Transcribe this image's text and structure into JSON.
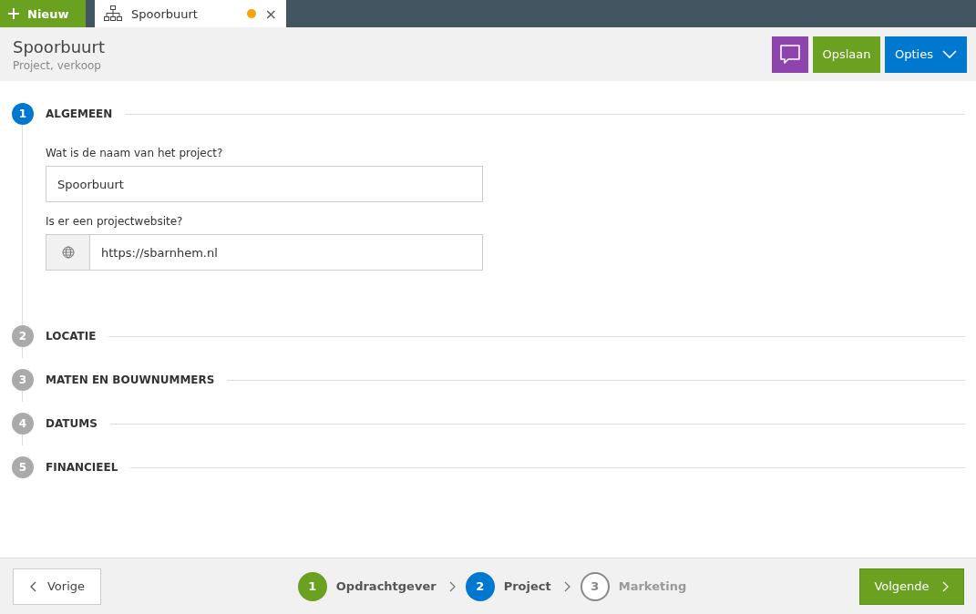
{
  "top_bar": {
    "new_button": {
      "label": "Nieuw"
    },
    "tabs": [
      {
        "label": "Spoorbuurt",
        "selected": true,
        "unsaved": true,
        "close": "×"
      }
    ]
  },
  "header": {
    "title": "Spoorbuurt",
    "subtitle": "Project, verkoop",
    "buttons": [
      {
        "kind": "comment"
      },
      {
        "kind": "save",
        "label": "Opslaan"
      },
      {
        "kind": "options",
        "label": "Opties"
      }
    ]
  },
  "sections": [
    {
      "number": "1",
      "title": "ALGEMEEN",
      "expanded": true,
      "fields": [
        {
          "label": "Wat is de naam van het project?",
          "value": "Spoorbuurt",
          "kind": "text"
        },
        {
          "label": "Is er een projectwebsite?",
          "value": "https://sbarnhem.nl",
          "kind": "url"
        }
      ]
    },
    {
      "number": "2",
      "title": "LOCATIE",
      "expanded": false
    },
    {
      "number": "3",
      "title": "MATEN EN BOUWNUMMERS",
      "expanded": false
    },
    {
      "number": "4",
      "title": "DATUMS",
      "expanded": false
    },
    {
      "number": "5",
      "title": "FINANCIEEL",
      "expanded": false
    }
  ],
  "footer": {
    "previous": {
      "label": "Vorige"
    },
    "steps": [
      {
        "number": "1",
        "label": "Opdrachtgever",
        "kind": "done"
      },
      {
        "number": "2",
        "label": "Project",
        "kind": "current"
      },
      {
        "number": "3",
        "label": "Marketing",
        "kind": "todo"
      }
    ],
    "next": {
      "label": "Volgende"
    }
  }
}
